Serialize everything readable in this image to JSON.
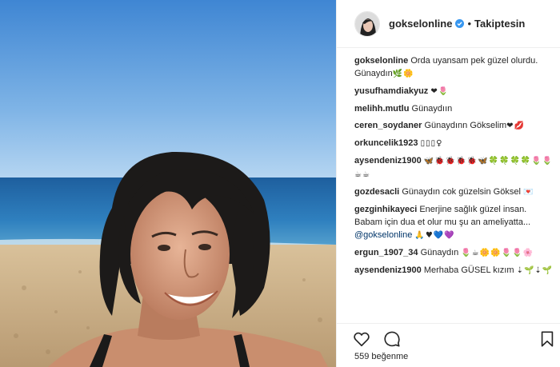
{
  "post": {
    "username": "gokselonline",
    "follow_status": "Takiptesin",
    "separator": "•"
  },
  "comments": [
    {
      "user": "gokselonline",
      "text": "Orda uyansam pek güzel olurdu. Günaydın",
      "emoji": "🌿🌼"
    },
    {
      "user": "yusufhamdiakyuz",
      "text": "",
      "emoji": "❤🌷"
    },
    {
      "user": "melihh.mutlu",
      "text": "Günaydıın",
      "emoji": ""
    },
    {
      "user": "ceren_soydaner",
      "text": "Günaydınn Gökselim",
      "emoji": "❤💋"
    },
    {
      "user": "orkuncelik1923",
      "text": "",
      "emoji": "▯▯▯♀"
    },
    {
      "user": "aysendeniz1900",
      "text": "",
      "emoji": "🦋🐞🐞🐞🐞🦋🍀🍀🍀🍀🌷🌷☕☕"
    },
    {
      "user": "gozdesacli",
      "text": "Günaydın cok güzelsin Göksel",
      "emoji": "💌"
    },
    {
      "user": "gezginhikayeci",
      "text": "Enerjine sağlık güzel insan. Babam için dua et olur mu şu an ameliyatta...",
      "mention": "@gokselonline",
      "emoji": "🙏♥💙💜"
    },
    {
      "user": "ergun_1907_34",
      "text": "Günaydın",
      "emoji": "🌷☕🌼🌼🌷🌷🌸"
    },
    {
      "user": "aysendeniz1900",
      "text": "Merhaba GÜSEL kızım",
      "emoji": "⇣🌱⇣🌱"
    }
  ],
  "actions": {
    "like_icon": "heart-icon",
    "comment_icon": "speech-bubble-icon",
    "save_icon": "bookmark-icon"
  },
  "likes": {
    "count": "559",
    "label": "beğenme"
  },
  "colors": {
    "sky_top": "#4a8fd6",
    "sky_bottom": "#b9d8f2",
    "sea": "#2a78b5",
    "sand": "#c9ae86",
    "verified": "#3897f0"
  }
}
